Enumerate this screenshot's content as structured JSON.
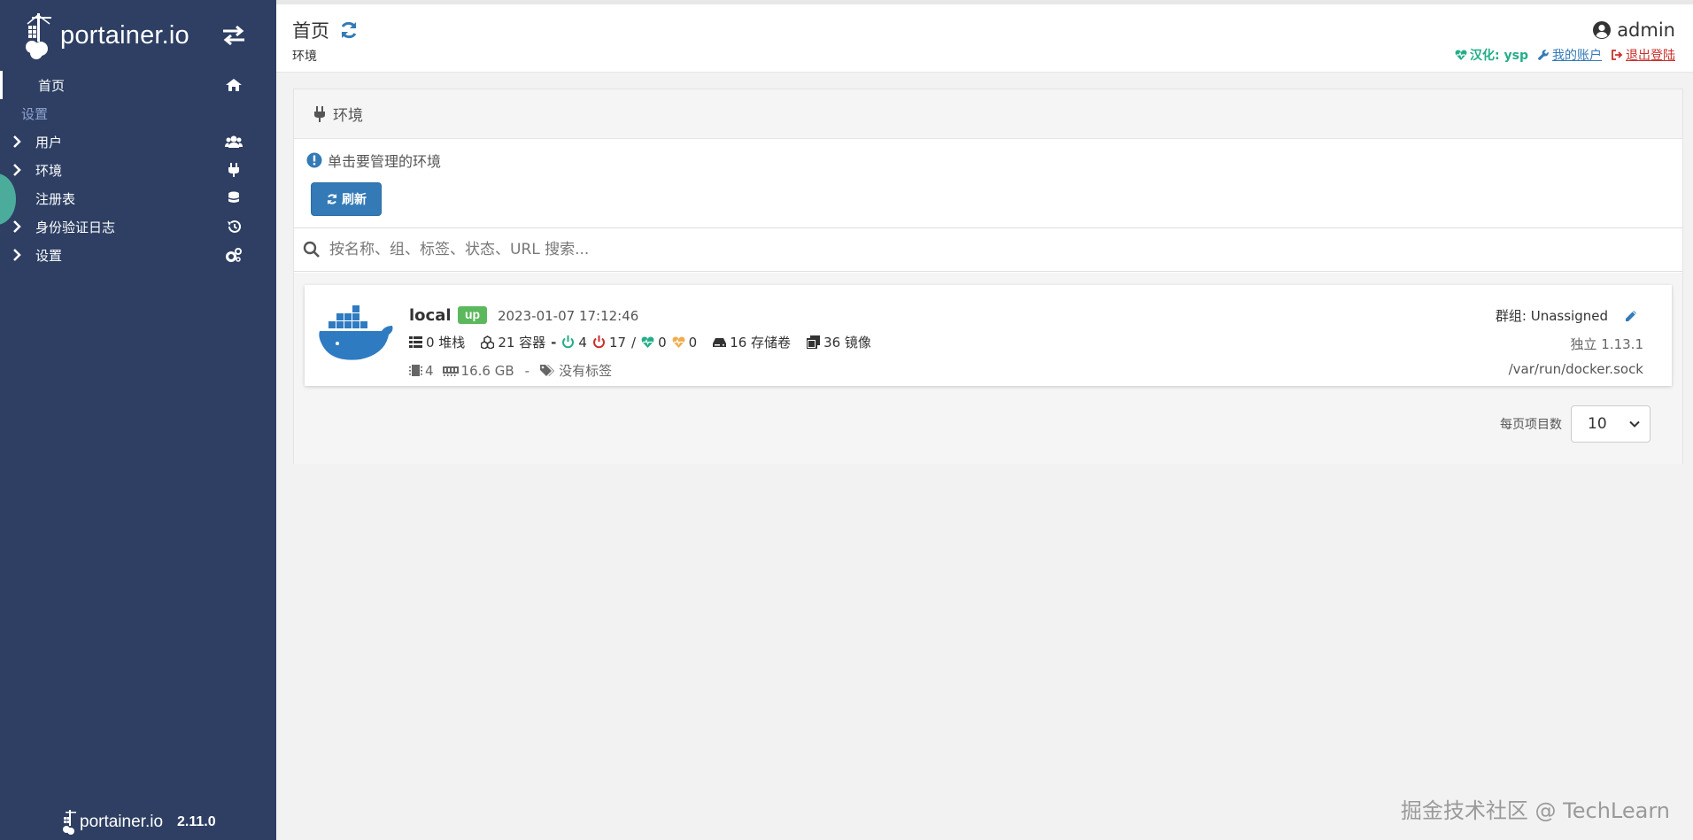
{
  "colors": {
    "sidebar": "#2e3f63",
    "accent": "#337ab7",
    "up": "#5cb85c",
    "success": "#23ae89",
    "danger": "#c9302c"
  },
  "brand": {
    "name": "portainer.io",
    "version": "2.11.0"
  },
  "sidebar": {
    "home_label": "首页",
    "section_heading": "设置",
    "items": [
      {
        "label": "用户",
        "icon": "users-icon"
      },
      {
        "label": "环境",
        "icon": "plug-icon"
      },
      {
        "label": "注册表",
        "icon": "database-icon"
      },
      {
        "label": "身份验证日志",
        "icon": "history-icon"
      },
      {
        "label": "设置",
        "icon": "cogs-icon"
      }
    ]
  },
  "header": {
    "title": "首页",
    "breadcrumb": "环境",
    "user": "admin",
    "localization": "汉化: ysp",
    "my_account": "我的账户",
    "logout": "退出登陆"
  },
  "widget": {
    "title": "环境",
    "hint": "单击要管理的环境",
    "refresh_label": "刷新",
    "search_placeholder": "按名称、组、标签、状态、URL 搜索..."
  },
  "environment": {
    "name": "local",
    "status": "up",
    "timestamp": "2023-01-07 17:12:46",
    "stacks": "0 堆栈",
    "containers": "21 容器",
    "dash": "-",
    "running": "4",
    "stopped": "17",
    "slash": "/",
    "healthy": "0",
    "unhealthy": "0",
    "volumes": "16 存储卷",
    "images": "36 镜像",
    "cpu": "4",
    "memory": "16.6 GB",
    "meta_dash": "-",
    "tags": "没有标签",
    "group": "群组: Unassigned",
    "type": "独立 1.13.1",
    "url": "/var/run/docker.sock"
  },
  "pagination": {
    "label": "每页项目数",
    "value": "10"
  },
  "watermark": "掘金技术社区 @ TechLearn"
}
